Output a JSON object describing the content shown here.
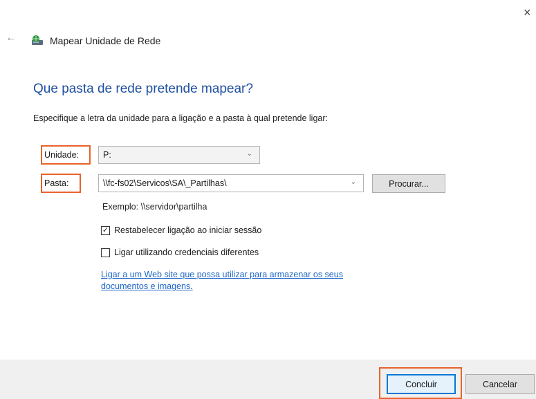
{
  "window": {
    "close_glyph": "×",
    "back_glyph": "←",
    "title": "Mapear Unidade de Rede",
    "icon": "network-drive-icon"
  },
  "main": {
    "heading": "Que pasta de rede pretende mapear?",
    "instruction": "Especifique a letra da unidade para a ligação e a pasta à qual pretende ligar:",
    "drive_label": "Unidade:",
    "drive_value": "P:",
    "folder_label": "Pasta:",
    "folder_value": "\\\\fc-fs02\\Servicos\\SA\\_Partilhas\\",
    "browse_label": "Procurar...",
    "example": "Exemplo: \\\\servidor\\partilha",
    "reconnect_label": "Restabelecer ligação ao iniciar sessão",
    "reconnect_checked": true,
    "credentials_label": "Ligar utilizando credenciais diferentes",
    "credentials_checked": false,
    "link_text": "Ligar a um Web site que possa utilizar para armazenar os seus documentos e imagens",
    "link_suffix": "."
  },
  "footer": {
    "finish_label": "Concluir",
    "cancel_label": "Cancelar"
  },
  "colors": {
    "accent": "#1e4fa1",
    "highlight": "#e8622c",
    "link": "#1e66c9"
  }
}
